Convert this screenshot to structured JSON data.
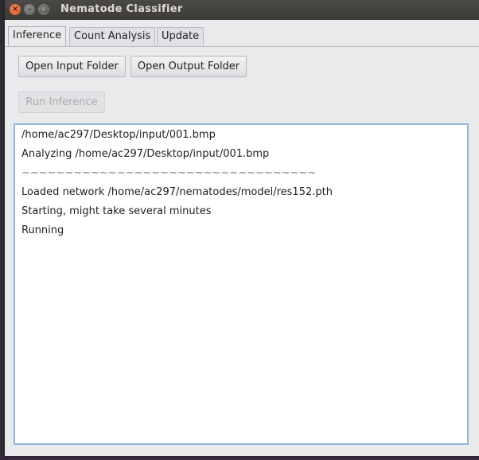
{
  "window": {
    "title": "Nematode Classifier"
  },
  "tabs": [
    {
      "label": "Inference",
      "active": true
    },
    {
      "label": "Count Analysis",
      "active": false
    },
    {
      "label": "Update",
      "active": false
    }
  ],
  "buttons": {
    "open_input": "Open Input Folder",
    "open_output": "Open Output Folder",
    "run_inference": "Run Inference"
  },
  "run_inference_enabled": false,
  "log": {
    "lines": [
      "/home/ac297/Desktop/input/001.bmp",
      "Analyzing /home/ac297/Desktop/input/001.bmp",
      "~~~~~~~~~~~~~~~~~~~~~~~~~~~~~~~~~~",
      "Loaded network /home/ac297/nematodes/model/res152.pth",
      "Starting, might take several minutes",
      "Running"
    ]
  },
  "icons": {
    "close": "close-icon",
    "minimize": "minimize-icon",
    "maximize": "maximize-icon"
  },
  "colors": {
    "titlebar": "#3c3b37",
    "close_button": "#e8612c",
    "focus_border": "#8fb6df",
    "window_bg": "#e9eaec"
  }
}
